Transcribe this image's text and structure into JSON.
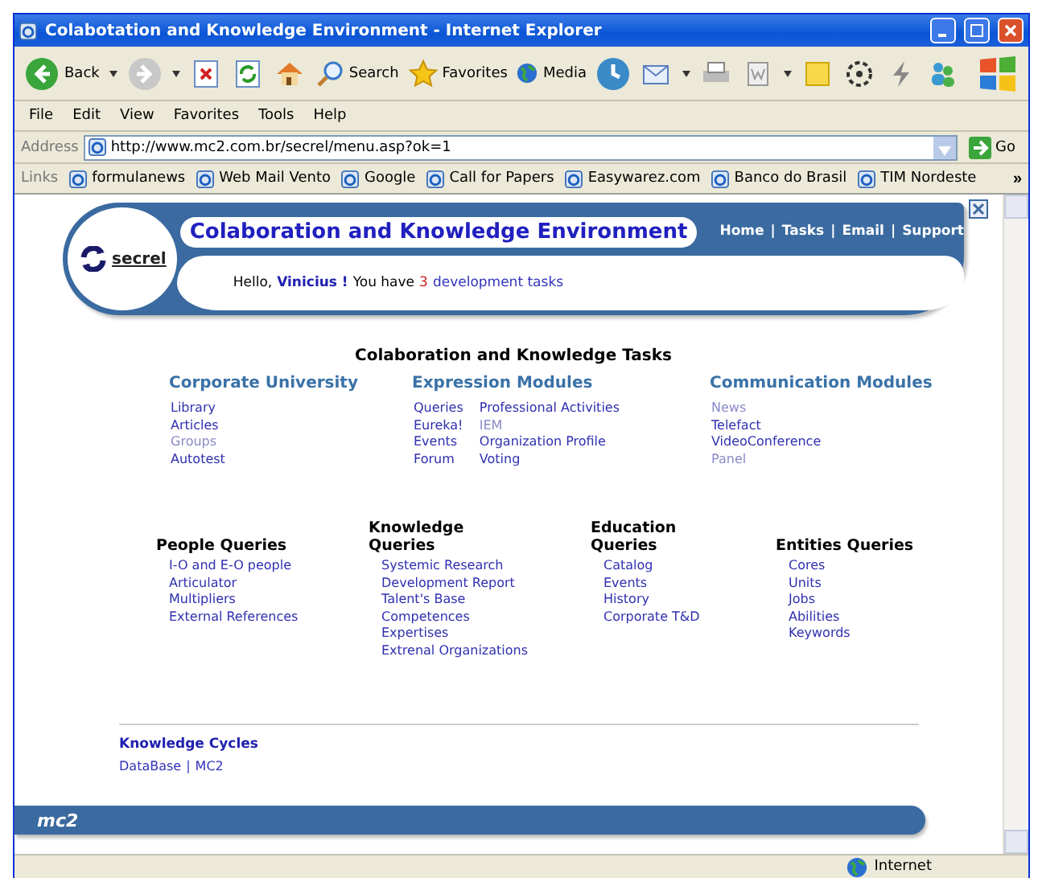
{
  "window": {
    "title": "Colabotation and Knowledge Environment - Internet Explorer"
  },
  "toolbar": {
    "back": "Back",
    "search": "Search",
    "favorites": "Favorites",
    "media": "Media"
  },
  "menu": [
    "File",
    "Edit",
    "View",
    "Favorites",
    "Tools",
    "Help"
  ],
  "address": {
    "label": "Address",
    "value": "http://www.mc2.com.br/secrel/menu.asp?ok=1",
    "go": "Go"
  },
  "links": {
    "label": "Links",
    "items": [
      "formulanews",
      "Web Mail Vento",
      "Google",
      "Call for Papers",
      "Easywarez.com",
      "Banco do Brasil",
      "TIM Nordeste"
    ],
    "more": "»"
  },
  "banner": {
    "logo": "secrel",
    "title": "Colaboration and Knowledge Environment",
    "nav": [
      "Home",
      "Tasks",
      "Email",
      "Support"
    ],
    "separator": "|",
    "greeting": {
      "before": "Hello,",
      "name": "Vinicius !",
      "middle": "You have",
      "count": "3",
      "link": "development tasks"
    }
  },
  "tasks_title": "Colaboration and Knowledge Tasks",
  "modules": [
    {
      "title": "Corporate University",
      "columns": [
        [
          {
            "label": "Library",
            "disabled": false
          },
          {
            "label": "Articles",
            "disabled": false
          },
          {
            "label": "Groups",
            "disabled": true
          },
          {
            "label": "Autotest",
            "disabled": false
          }
        ]
      ]
    },
    {
      "title": "Expression Modules",
      "columns": [
        [
          {
            "label": "Queries",
            "disabled": false
          },
          {
            "label": "Eureka!",
            "disabled": false
          },
          {
            "label": "Events",
            "disabled": false
          },
          {
            "label": "Forum",
            "disabled": false
          }
        ],
        [
          {
            "label": "Professional Activities",
            "disabled": false
          },
          {
            "label": "IEM",
            "disabled": true
          },
          {
            "label": "Organization Profile",
            "disabled": false
          },
          {
            "label": "Voting",
            "disabled": false
          }
        ]
      ]
    },
    {
      "title": "Communication Modules",
      "columns": [
        [
          {
            "label": "News",
            "disabled": true
          },
          {
            "label": "Telefact",
            "disabled": false
          },
          {
            "label": "VideoConference",
            "disabled": false
          },
          {
            "label": "Panel",
            "disabled": true
          }
        ]
      ]
    }
  ],
  "queries": [
    {
      "title": "People Queries",
      "items": [
        "I-O and E-O people",
        "Articulator",
        "Multipliers",
        "External References"
      ]
    },
    {
      "title": "Knowledge Queries",
      "items": [
        "Systemic Research",
        "Development Report",
        "Talent's Base",
        "Competences",
        "Expertises",
        "Extrenal Organizations"
      ]
    },
    {
      "title": "Education Queries",
      "items": [
        "Catalog",
        "Events",
        "History",
        "Corporate T&D"
      ]
    },
    {
      "title": "Entities Queries",
      "items": [
        "Cores",
        "Units",
        "Jobs",
        "Abilities",
        "Keywords"
      ]
    }
  ],
  "cycles": {
    "title": "Knowledge Cycles",
    "links": [
      "DataBase",
      "MC2"
    ],
    "separator": "|"
  },
  "footer": {
    "logo": "mc2"
  },
  "status_bar": {
    "zone": "Internet"
  }
}
